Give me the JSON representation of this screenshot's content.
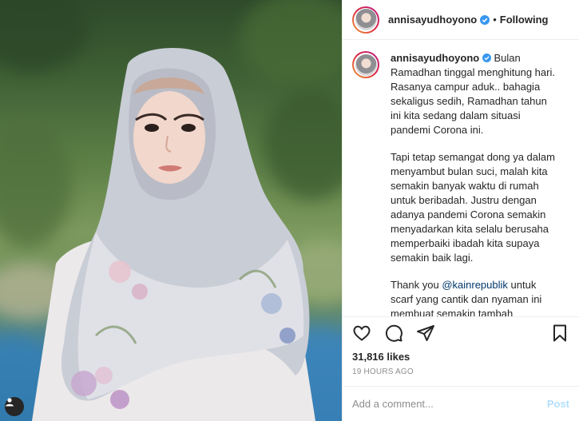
{
  "photo": {
    "alt_icon": "user-tag-icon"
  },
  "header": {
    "username": "annisayudhoyono",
    "separator": "•",
    "follow_state": "Following",
    "verified_icon": "verified-badge-icon"
  },
  "caption": {
    "username": "annisayudhoyono",
    "paragraphs": [
      "Bulan Ramadhan tinggal menghitung hari. Rasanya campur aduk.. bahagia sekaligus sedih, Ramadhan tahun ini kita sedang dalam situasi pandemi Corona ini.",
      "Tapi tetap semangat dong ya dalam menyambut bulan suci, malah kita semakin banyak waktu di rumah untuk beribadah. Justru dengan adanya pandemi Corona semakin menyadarkan kita selalu berusaha memperbaiki ibadah kita supaya semakin baik lagi."
    ],
    "para3_prefix": "Thank you ",
    "para3_mention": "@kainrepublik",
    "para3_suffix": " untuk scarf yang cantik dan nyaman ini membuat semakin tambah semangat menyambut bulan suci, oh ya scarf"
  },
  "actions": {
    "like_icon": "heart-icon",
    "comment_icon": "comment-icon",
    "share_icon": "share-icon",
    "save_icon": "bookmark-icon"
  },
  "likes": "31,816 likes",
  "timestamp": "19 HOURS AGO",
  "comment": {
    "placeholder": "Add a comment...",
    "post_label": "Post"
  },
  "colors": {
    "link": "#00376b",
    "verified": "#3897f0",
    "post_disabled": "#b2dffc",
    "muted": "#8e8e8e"
  }
}
